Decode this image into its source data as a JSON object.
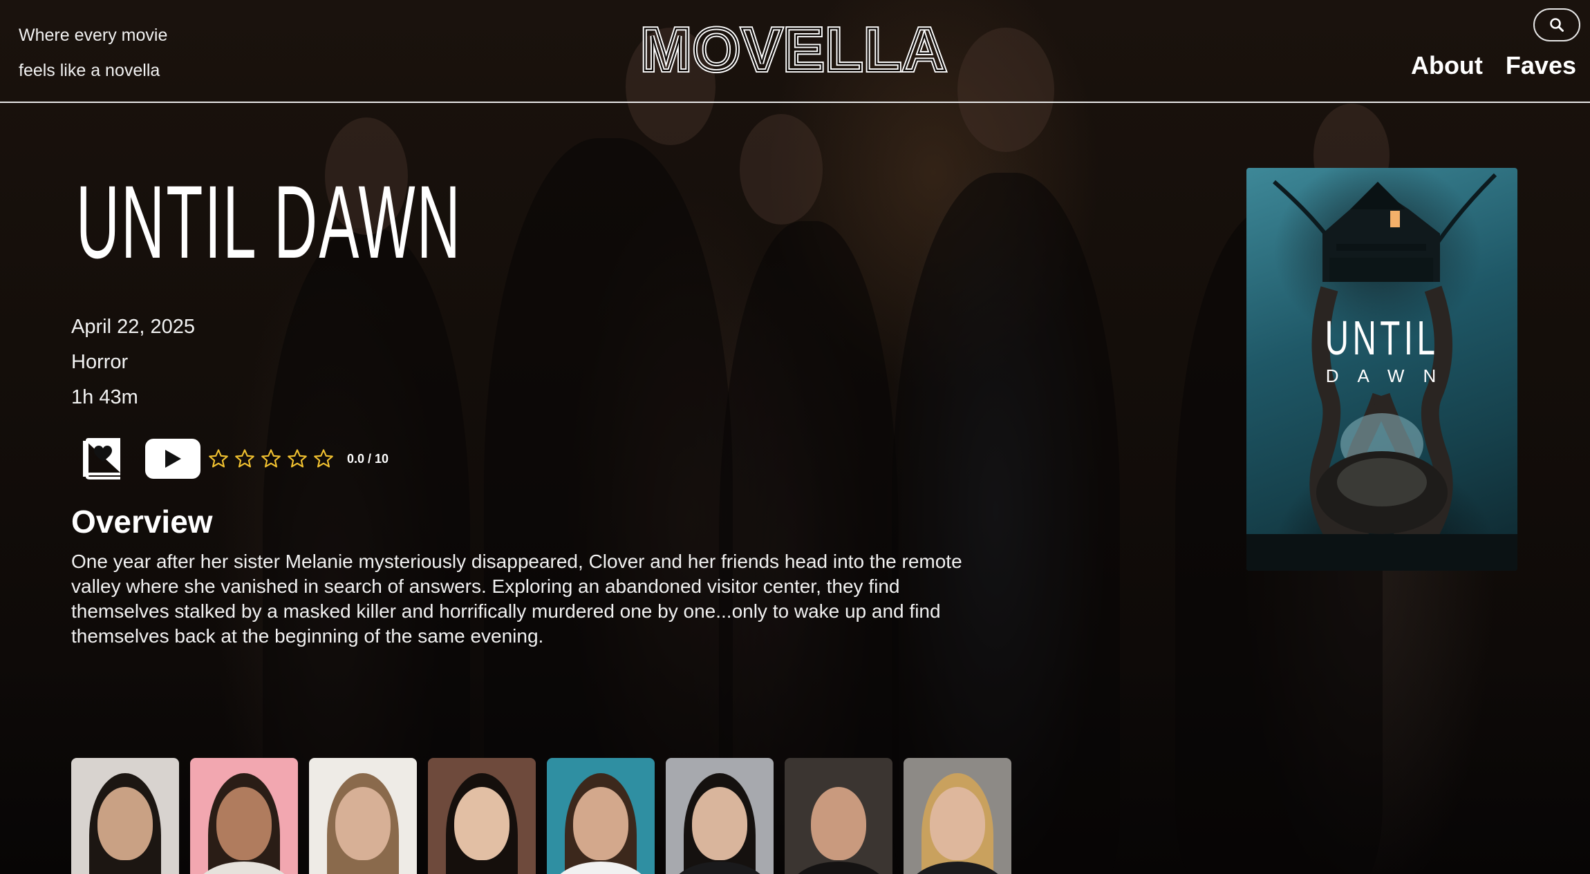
{
  "header": {
    "tagline_line1": "Where every movie",
    "tagline_line2": "feels like a novella",
    "logo_text": "MOVELLA",
    "search_icon": "search-icon",
    "nav": {
      "about": "About",
      "faves": "Faves"
    }
  },
  "movie": {
    "title": "UNTIL DAWN",
    "release_date": "April 22, 2025",
    "genre": "Horror",
    "runtime": "1h 43m",
    "rating": {
      "stars_total": 5,
      "stars_filled": 0,
      "value_text": "0.0 / 10"
    },
    "actions": {
      "fave_icon": "bookmark-heart-icon",
      "trailer_icon": "play-icon"
    },
    "overview_heading": "Overview",
    "overview": "One year after her sister Melanie mysteriously disappeared, Clover and her friends head into the remote valley where she vanished in search of answers. Exploring an abandoned visitor center, they find themselves stalked by a masked killer and horrifically murdered one by one...only to wake up and find themselves back at the beginning of the same evening."
  },
  "poster": {
    "title_line1": "UNTIL",
    "title_line2": "DAWN"
  },
  "colors": {
    "star_outline": "#f2c230",
    "background": "#0b0807",
    "text": "#ffffff"
  }
}
